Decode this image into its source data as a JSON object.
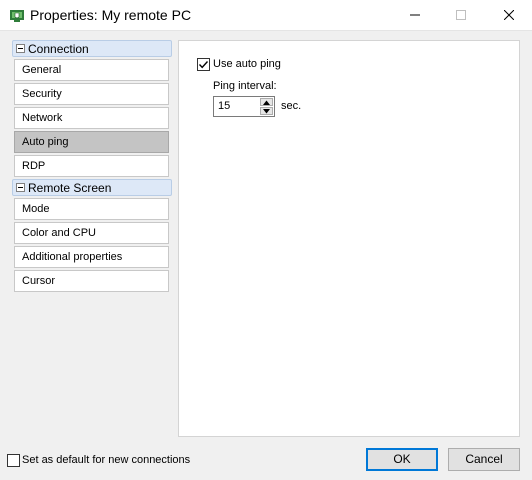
{
  "window": {
    "title": "Properties: My remote PC",
    "icon": "remote-pc-shield-icon",
    "controls": [
      "minimize-icon",
      "maximize-icon",
      "close-icon"
    ]
  },
  "sidebar": {
    "groups": [
      {
        "label": "Connection",
        "items": [
          "General",
          "Security",
          "Network",
          "Auto ping",
          "RDP"
        ]
      },
      {
        "label": "Remote Screen",
        "items": [
          "Mode",
          "Color and CPU",
          "Additional properties",
          "Cursor"
        ]
      }
    ],
    "selected": "Auto ping"
  },
  "autoping": {
    "use_label": "Use auto ping",
    "use_checked": true,
    "interval_label": "Ping interval:",
    "interval_value": "15",
    "interval_unit": "sec."
  },
  "footer": {
    "default_label": "Set as default for new connections",
    "default_checked": false,
    "ok_label": "OK",
    "cancel_label": "Cancel"
  },
  "colors": {
    "group_header_bg": "#dde8f7",
    "selected_item_bg": "#c4c4c4",
    "ok_border": "#0078d7",
    "icon_green": "#2f7d3a"
  }
}
